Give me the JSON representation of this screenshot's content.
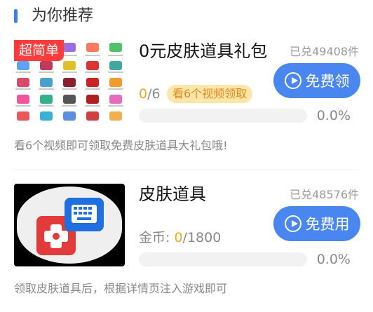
{
  "section": {
    "title": "为你推荐"
  },
  "items": [
    {
      "tag": "超简单",
      "title": "0元皮肤道具礼包",
      "redeemed": "已兑49408件",
      "button_label": "免费领",
      "progress": {
        "current": "0",
        "sep": "/",
        "total": "6"
      },
      "task_label": "看6个视频领取",
      "progress_fraction": 0.0,
      "percent": "0.0%",
      "description": "看6个视频即可领取免费皮肤道具大礼包哦!"
    },
    {
      "title": "皮肤道具",
      "redeemed": "已兑48576件",
      "button_label": "免费用",
      "coins_label": "金币: ",
      "progress": {
        "current": "0",
        "sep": "/",
        "total": "1800"
      },
      "progress_fraction": 0.0,
      "percent": "0.0%",
      "description": "领取皮肤道具后，根据详情页注入游戏即可"
    }
  ],
  "colors": {
    "accent": "#4a86ef",
    "tag_red": "#ff3b3b",
    "highlight": "#f5a623",
    "task_bg": "#fde7a8"
  },
  "icons": {
    "play": "play-circle-icon",
    "keyboard": "keyboard-icon",
    "gamepad": "gamepad-icon"
  }
}
